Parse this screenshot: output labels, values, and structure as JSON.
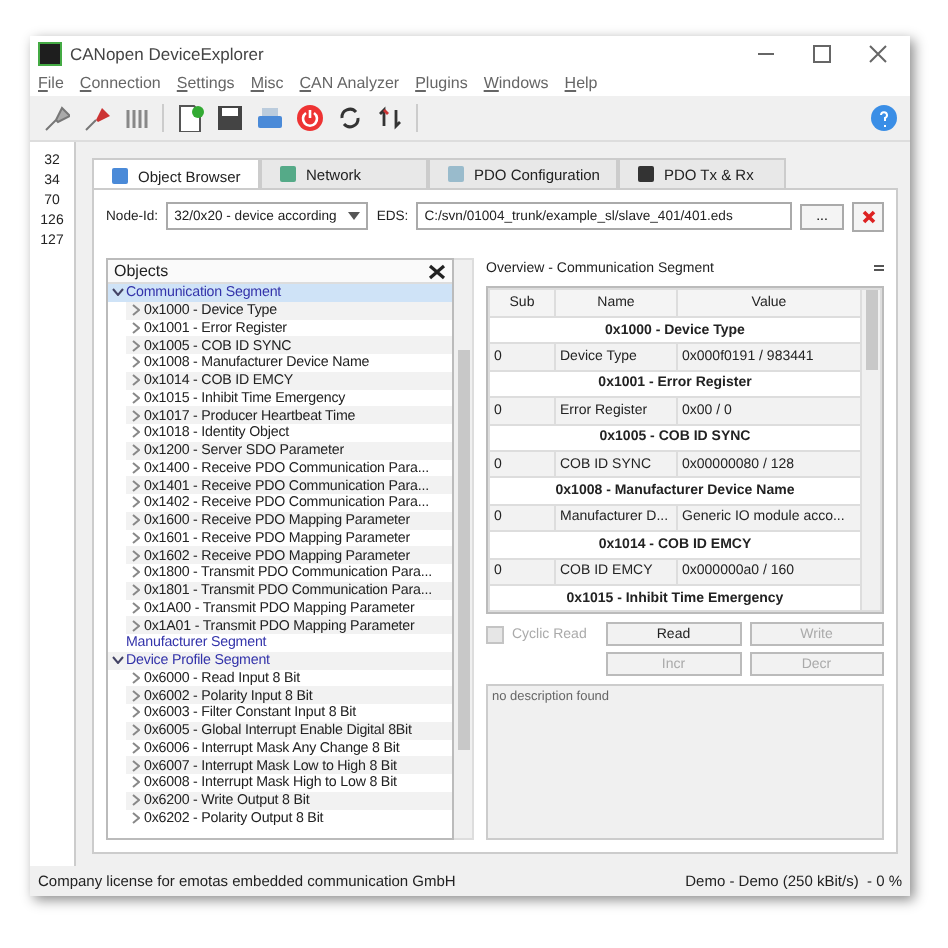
{
  "window": {
    "title": "CANopen DeviceExplorer"
  },
  "menu": [
    "File",
    "Connection",
    "Settings",
    "Misc",
    "CAN Analyzer",
    "Plugins",
    "Windows",
    "Help"
  ],
  "node_list": [
    "32",
    "34",
    "70",
    "126",
    "127"
  ],
  "tabs": [
    {
      "label": "Object Browser",
      "selected": true
    },
    {
      "label": "Network",
      "selected": false
    },
    {
      "label": "PDO Configuration",
      "selected": false
    },
    {
      "label": "PDO Tx & Rx",
      "selected": false
    }
  ],
  "node_id": {
    "label": "Node-Id:",
    "value": "32/0x20 - device according"
  },
  "eds": {
    "label": "EDS:",
    "value": "C:/svn/01004_trunk/example_sl/slave_401/401.eds",
    "browse": "..."
  },
  "objects": {
    "title": "Objects",
    "tree": [
      {
        "label": "Communication Segment",
        "selected": true,
        "expanded": true,
        "children": [
          {
            "label": "0x1000 - Device Type",
            "selected": false,
            "expanded": false
          },
          {
            "label": "0x1001 - Error Register",
            "selected": false,
            "expanded": false
          },
          {
            "label": "0x1005 - COB ID SYNC",
            "selected": false,
            "expanded": false
          },
          {
            "label": "0x1008 - Manufacturer Device Name",
            "selected": false,
            "expanded": false
          },
          {
            "label": "0x1014 - COB ID EMCY",
            "selected": false,
            "expanded": false
          },
          {
            "label": "0x1015 - Inhibit Time Emergency",
            "selected": false,
            "expanded": false
          },
          {
            "label": "0x1017 - Producer Heartbeat Time",
            "selected": false,
            "expanded": false
          },
          {
            "label": "0x1018 - Identity Object",
            "selected": false,
            "expanded": false
          },
          {
            "label": "0x1200 - Server SDO Parameter",
            "selected": false,
            "expanded": false
          },
          {
            "label": "0x1400 - Receive PDO Communication Para...",
            "selected": false,
            "expanded": false
          },
          {
            "label": "0x1401 - Receive PDO Communication Para...",
            "selected": false,
            "expanded": false
          },
          {
            "label": "0x1402 - Receive PDO Communication Para...",
            "selected": false,
            "expanded": false
          },
          {
            "label": "0x1600 - Receive PDO Mapping Parameter",
            "selected": false,
            "expanded": false
          },
          {
            "label": "0x1601 - Receive PDO Mapping Parameter",
            "selected": false,
            "expanded": false
          },
          {
            "label": "0x1602 - Receive PDO Mapping Parameter",
            "selected": false,
            "expanded": false
          },
          {
            "label": "0x1800 - Transmit PDO Communication Para...",
            "selected": false,
            "expanded": false
          },
          {
            "label": "0x1801 - Transmit PDO Communication Para...",
            "selected": false,
            "expanded": false
          },
          {
            "label": "0x1A00 - Transmit PDO Mapping Parameter",
            "selected": false,
            "expanded": false
          },
          {
            "label": "0x1A01 - Transmit PDO Mapping Parameter",
            "selected": false,
            "expanded": false
          }
        ]
      },
      {
        "label": "Manufacturer Segment",
        "selected": false,
        "expanded": false,
        "has_children": false
      },
      {
        "label": "Device Profile Segment",
        "selected": false,
        "expanded": true,
        "children": [
          {
            "label": "0x6000 - Read Input 8 Bit",
            "selected": false,
            "expanded": false
          },
          {
            "label": "0x6002 - Polarity Input 8 Bit",
            "selected": false,
            "expanded": false
          },
          {
            "label": "0x6003 - Filter Constant Input 8 Bit",
            "selected": false,
            "expanded": false
          },
          {
            "label": "0x6005 - Global Interrupt Enable Digital 8Bit",
            "selected": false,
            "expanded": false
          },
          {
            "label": "0x6006 - Interrupt Mask Any Change 8 Bit",
            "selected": false,
            "expanded": false
          },
          {
            "label": "0x6007 - Interrupt Mask Low to High 8 Bit",
            "selected": false,
            "expanded": false
          },
          {
            "label": "0x6008 - Interrupt Mask High to Low 8 Bit",
            "selected": false,
            "expanded": false
          },
          {
            "label": "0x6200 - Write Output 8 Bit",
            "selected": false,
            "expanded": false
          },
          {
            "label": "0x6202 - Polarity Output 8 Bit",
            "selected": false,
            "expanded": false
          }
        ]
      }
    ]
  },
  "overview": {
    "title": "Overview - Communication Segment",
    "columns": [
      "Sub",
      "Name",
      "Value"
    ],
    "rows": [
      {
        "kind": "group",
        "label": "0x1000 - Device Type"
      },
      {
        "kind": "entry",
        "cells": [
          "0",
          "Device Type",
          "0x000f0191 / 983441"
        ]
      },
      {
        "kind": "group",
        "label": "0x1001 - Error Register"
      },
      {
        "kind": "entry",
        "cells": [
          "0",
          "Error Register",
          "0x00 / 0"
        ]
      },
      {
        "kind": "group",
        "label": "0x1005 - COB ID SYNC"
      },
      {
        "kind": "entry",
        "cells": [
          "0",
          "COB ID SYNC",
          "0x00000080 / 128"
        ]
      },
      {
        "kind": "group",
        "label": "0x1008 - Manufacturer Device Name"
      },
      {
        "kind": "entry",
        "cells": [
          "0",
          "Manufacturer D...",
          "Generic IO module acco..."
        ]
      },
      {
        "kind": "group",
        "label": "0x1014 - COB ID EMCY"
      },
      {
        "kind": "entry",
        "cells": [
          "0",
          "COB ID EMCY",
          "0x000000a0 / 160"
        ]
      },
      {
        "kind": "group",
        "label": "0x1015 - Inhibit Time Emergency"
      }
    ]
  },
  "cyclic_read": {
    "label": "Cyclic Read",
    "checked": false,
    "disabled": true
  },
  "buttons": [
    {
      "label": "Read",
      "disabled": false
    },
    {
      "label": "Write",
      "disabled": true
    },
    {
      "label": "Incr",
      "disabled": true
    },
    {
      "label": "Decr",
      "disabled": true
    }
  ],
  "description": "no description found",
  "status_bar": {
    "left": "Company license for emotas embedded communication GmbH",
    "right": "Demo - Demo (250 kBit/s)  - 0 %"
  }
}
